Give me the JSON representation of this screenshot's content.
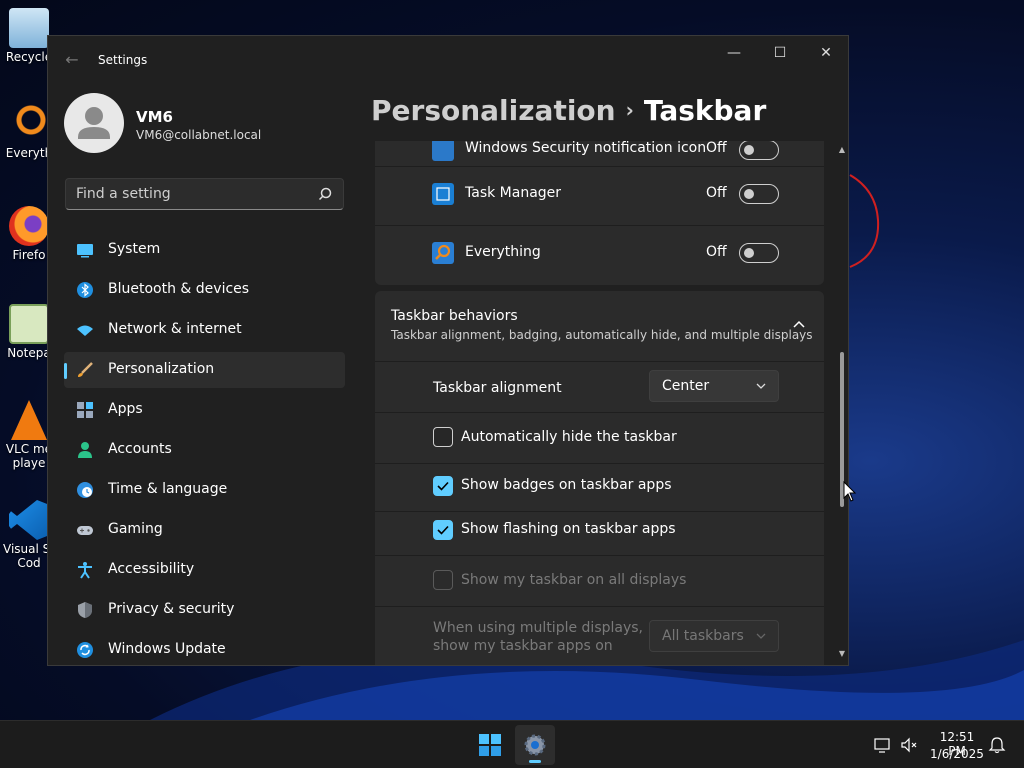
{
  "desktop": {
    "icons": [
      {
        "label": "Recycle",
        "icon": "recycle-bin-icon"
      },
      {
        "label": "Everyth",
        "icon": "everything-search-icon"
      },
      {
        "label": "Firefo",
        "icon": "firefox-icon"
      },
      {
        "label": "Notepa",
        "icon": "notepad-icon"
      },
      {
        "label": "VLC me",
        "label2": "playe",
        "icon": "vlc-icon"
      },
      {
        "label": "Visual St",
        "label2": "Cod",
        "icon": "vscode-icon"
      }
    ]
  },
  "window": {
    "title": "Settings",
    "controls": {
      "minimize": "—",
      "maximize": "☐",
      "close": "✕"
    }
  },
  "profile": {
    "name": "VM6",
    "email": "VM6@collabnet.local"
  },
  "search": {
    "placeholder": "Find a setting",
    "icon": "search-icon"
  },
  "sidebar": {
    "items": [
      {
        "label": "System",
        "icon": "system-icon",
        "active": false
      },
      {
        "label": "Bluetooth & devices",
        "icon": "bluetooth-icon",
        "active": false
      },
      {
        "label": "Network & internet",
        "icon": "wifi-icon",
        "active": false
      },
      {
        "label": "Personalization",
        "icon": "brush-icon",
        "active": true
      },
      {
        "label": "Apps",
        "icon": "apps-icon",
        "active": false
      },
      {
        "label": "Accounts",
        "icon": "accounts-icon",
        "active": false
      },
      {
        "label": "Time & language",
        "icon": "globe-clock-icon",
        "active": false
      },
      {
        "label": "Gaming",
        "icon": "gamepad-icon",
        "active": false
      },
      {
        "label": "Accessibility",
        "icon": "accessibility-icon",
        "active": false
      },
      {
        "label": "Privacy & security",
        "icon": "shield-icon",
        "active": false
      },
      {
        "label": "Windows Update",
        "icon": "update-icon",
        "active": false
      }
    ]
  },
  "breadcrumb": {
    "parent": "Personalization",
    "separator": "›",
    "current": "Taskbar"
  },
  "tray_icons": {
    "partial": {
      "label": "Windows Security notification icon",
      "state": "Off"
    },
    "items": [
      {
        "label": "Task Manager",
        "state": "Off",
        "icon": "task-manager-icon"
      },
      {
        "label": "Everything",
        "state": "Off",
        "icon": "everything-icon"
      }
    ]
  },
  "behaviors": {
    "title": "Taskbar behaviors",
    "subtitle": "Taskbar alignment, badging, automatically hide, and multiple displays",
    "alignment": {
      "label": "Taskbar alignment",
      "value": "Center"
    },
    "options": [
      {
        "label": "Automatically hide the taskbar",
        "checked": false,
        "disabled": false
      },
      {
        "label": "Show badges on taskbar apps",
        "checked": true,
        "disabled": false
      },
      {
        "label": "Show flashing on taskbar apps",
        "checked": true,
        "disabled": false
      },
      {
        "label": "Show my taskbar on all displays",
        "checked": false,
        "disabled": true
      }
    ],
    "multi_display": {
      "line1": "When using multiple displays,",
      "line2": "show my taskbar apps on",
      "value": "All taskbars"
    }
  },
  "taskbar": {
    "clock": {
      "time": "12:51 PM",
      "date": "1/6/2025"
    },
    "apps": [
      "start-icon",
      "settings-icon"
    ],
    "tray": [
      "network-monitor-icon",
      "volume-muted-icon",
      "notification-bell-icon"
    ]
  },
  "colors": {
    "accent": "#60cdff",
    "window_bg": "#202020",
    "card_bg": "#2b2b2b"
  }
}
